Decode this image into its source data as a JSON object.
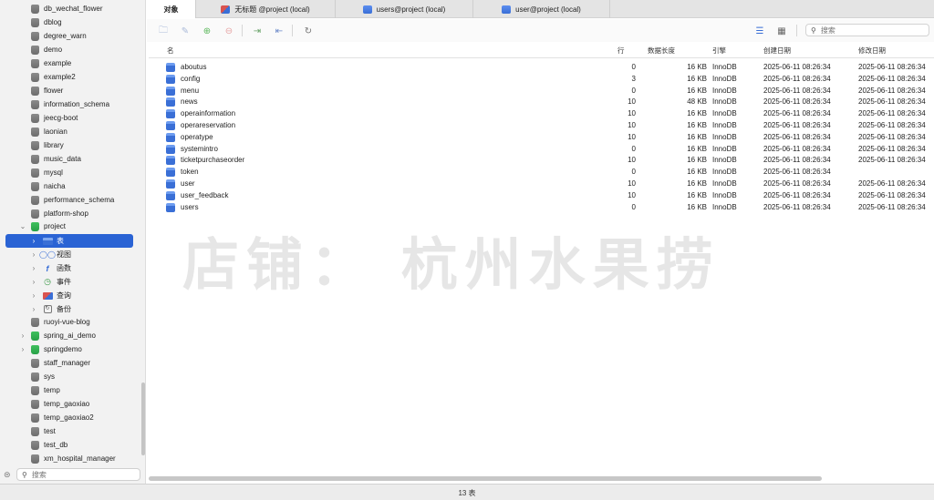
{
  "sidebar": {
    "databases_top": [
      {
        "name": "db_wechat_flower"
      },
      {
        "name": "dblog"
      },
      {
        "name": "degree_warn"
      },
      {
        "name": "demo"
      },
      {
        "name": "example"
      },
      {
        "name": "example2"
      },
      {
        "name": "flower"
      },
      {
        "name": "information_schema"
      },
      {
        "name": "jeecg-boot"
      },
      {
        "name": "laonian"
      },
      {
        "name": "library"
      },
      {
        "name": "music_data"
      },
      {
        "name": "mysql"
      },
      {
        "name": "naicha"
      },
      {
        "name": "performance_schema"
      },
      {
        "name": "platform-shop"
      }
    ],
    "open_db": {
      "name": "project",
      "expanded": true,
      "color": "#27a047"
    },
    "sub_items": [
      {
        "label": "表",
        "icon": "table-icon",
        "selected": true
      },
      {
        "label": "视图",
        "icon": "view-icon",
        "selected": false
      },
      {
        "label": "函数",
        "icon": "function-icon",
        "selected": false
      },
      {
        "label": "事件",
        "icon": "event-clock-icon",
        "selected": false
      },
      {
        "label": "查询",
        "icon": "query-icon",
        "selected": false
      },
      {
        "label": "备份",
        "icon": "backup-icon",
        "selected": false
      }
    ],
    "databases_bottom": [
      {
        "name": "ruoyi-vue-blog",
        "green": false,
        "collapsible": false
      },
      {
        "name": "spring_ai_demo",
        "green": true,
        "collapsible": true
      },
      {
        "name": "springdemo",
        "green": true,
        "collapsible": true
      },
      {
        "name": "staff_manager",
        "green": false,
        "collapsible": false
      },
      {
        "name": "sys",
        "green": false,
        "collapsible": false
      },
      {
        "name": "temp",
        "green": false,
        "collapsible": false
      },
      {
        "name": "temp_gaoxiao",
        "green": false,
        "collapsible": false
      },
      {
        "name": "temp_gaoxiao2",
        "green": false,
        "collapsible": false
      },
      {
        "name": "test",
        "green": false,
        "collapsible": false
      },
      {
        "name": "test_db",
        "green": false,
        "collapsible": false
      },
      {
        "name": "xm_hospital_manager",
        "green": false,
        "collapsible": false
      }
    ],
    "search_placeholder": "搜索"
  },
  "tabs": [
    {
      "label": "对象",
      "active": true,
      "icon": ""
    },
    {
      "label": "无标题 @project (local)",
      "active": false,
      "icon": "query-tab-icon"
    },
    {
      "label": "users@project (local)",
      "active": false,
      "icon": "table-tab-icon"
    },
    {
      "label": "user@project (local)",
      "active": false,
      "icon": "table-tab-icon"
    }
  ],
  "toolbar": {
    "search_placeholder": "搜索"
  },
  "table": {
    "headers": {
      "name": "名",
      "rows": "行",
      "data_length": "数据长度",
      "engine": "引擎",
      "created": "创建日期",
      "modified": "修改日期"
    },
    "rows": [
      {
        "name": "aboutus",
        "rows": "0",
        "size": "16 KB",
        "engine": "InnoDB",
        "created": "2025-06-11 08:26:34",
        "modified": "2025-06-11 08:26:34"
      },
      {
        "name": "config",
        "rows": "3",
        "size": "16 KB",
        "engine": "InnoDB",
        "created": "2025-06-11 08:26:34",
        "modified": "2025-06-11 08:26:34"
      },
      {
        "name": "menu",
        "rows": "0",
        "size": "16 KB",
        "engine": "InnoDB",
        "created": "2025-06-11 08:26:34",
        "modified": "2025-06-11 08:26:34"
      },
      {
        "name": "news",
        "rows": "10",
        "size": "48 KB",
        "engine": "InnoDB",
        "created": "2025-06-11 08:26:34",
        "modified": "2025-06-11 08:26:34"
      },
      {
        "name": "operainformation",
        "rows": "10",
        "size": "16 KB",
        "engine": "InnoDB",
        "created": "2025-06-11 08:26:34",
        "modified": "2025-06-11 08:26:34"
      },
      {
        "name": "operareservation",
        "rows": "10",
        "size": "16 KB",
        "engine": "InnoDB",
        "created": "2025-06-11 08:26:34",
        "modified": "2025-06-11 08:26:34"
      },
      {
        "name": "operatype",
        "rows": "10",
        "size": "16 KB",
        "engine": "InnoDB",
        "created": "2025-06-11 08:26:34",
        "modified": "2025-06-11 08:26:34"
      },
      {
        "name": "systemintro",
        "rows": "0",
        "size": "16 KB",
        "engine": "InnoDB",
        "created": "2025-06-11 08:26:34",
        "modified": "2025-06-11 08:26:34"
      },
      {
        "name": "ticketpurchaseorder",
        "rows": "10",
        "size": "16 KB",
        "engine": "InnoDB",
        "created": "2025-06-11 08:26:34",
        "modified": "2025-06-11 08:26:34"
      },
      {
        "name": "token",
        "rows": "0",
        "size": "16 KB",
        "engine": "InnoDB",
        "created": "2025-06-11 08:26:34",
        "modified": ""
      },
      {
        "name": "user",
        "rows": "10",
        "size": "16 KB",
        "engine": "InnoDB",
        "created": "2025-06-11 08:26:34",
        "modified": "2025-06-11 08:26:34"
      },
      {
        "name": "user_feedback",
        "rows": "10",
        "size": "16 KB",
        "engine": "InnoDB",
        "created": "2025-06-11 08:26:34",
        "modified": "2025-06-11 08:26:34"
      },
      {
        "name": "users",
        "rows": "0",
        "size": "16 KB",
        "engine": "InnoDB",
        "created": "2025-06-11 08:26:34",
        "modified": "2025-06-11 08:26:34"
      }
    ]
  },
  "status": {
    "text": "13 表"
  },
  "watermark": {
    "text": "店铺： 杭州水果捞"
  }
}
